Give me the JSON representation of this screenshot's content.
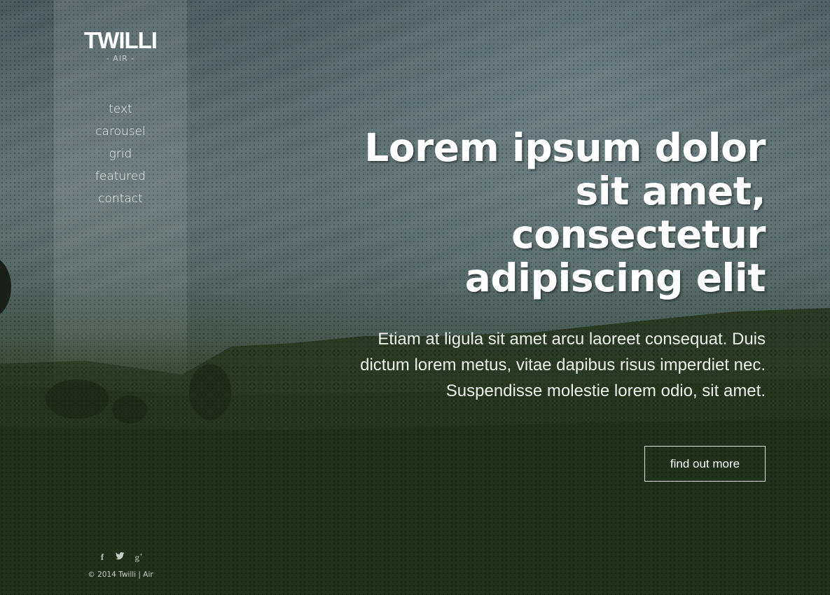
{
  "brand": {
    "logo": "TWILLI",
    "subtitle": "- AIR -"
  },
  "nav": {
    "items": [
      "text",
      "carousel",
      "grid",
      "featured",
      "contact"
    ]
  },
  "hero": {
    "title": "Lorem ipsum dolor sit amet, consectetur adipiscing elit",
    "body": "Etiam at ligula sit amet arcu laoreet consequat. Duis dictum lorem metus, vitae dapibus risus imperdiet nec. Suspendisse molestie lorem odio, sit amet.",
    "cta_label": "find out more"
  },
  "footer": {
    "social_icons": [
      "facebook-icon",
      "twitter-icon",
      "google-plus-icon"
    ],
    "copyright": "© 2014 Twilli | Air"
  }
}
